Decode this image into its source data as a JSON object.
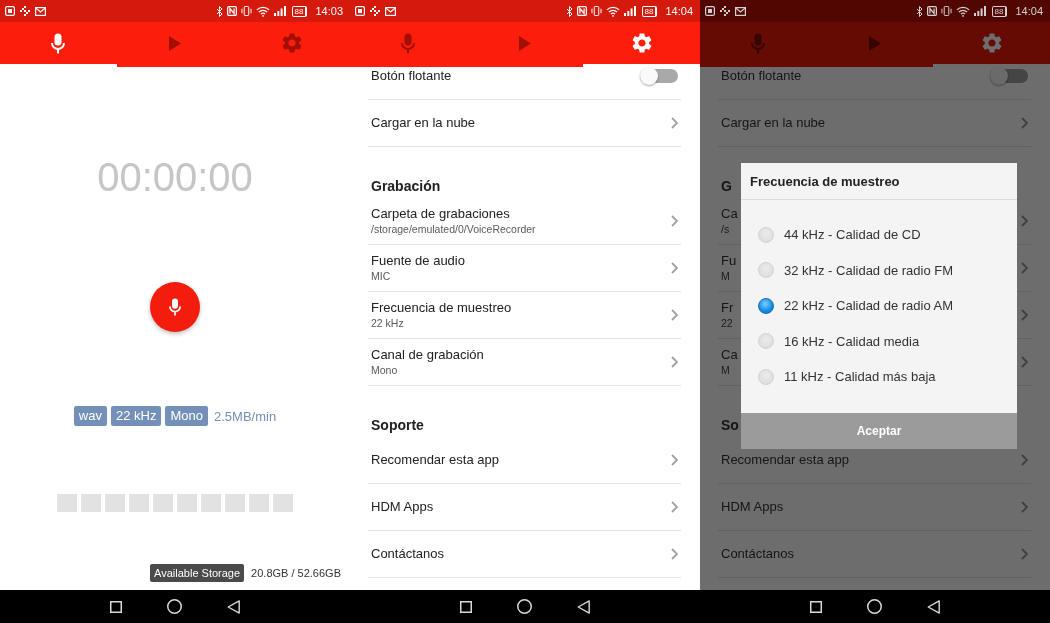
{
  "screens": [
    {
      "kind": "recorder",
      "dimmed": false,
      "status_bar": {
        "battery": "88",
        "time": "14:03"
      },
      "tabs": [
        {
          "kind": "microphone",
          "selected": true
        },
        {
          "kind": "play",
          "selected": false
        },
        {
          "kind": "settings",
          "selected": false
        }
      ],
      "timer": "00:00:00",
      "format_tags": [
        "wav",
        "22 kHz",
        "Mono"
      ],
      "bitrate": "2.5MB/min",
      "storage": {
        "label": "Available Storage",
        "value": "20.8GB / 52.66GB"
      }
    },
    {
      "kind": "settings",
      "dimmed": false,
      "status_bar": {
        "battery": "88",
        "time": "14:04"
      },
      "tabs": [
        {
          "kind": "microphone",
          "selected": false
        },
        {
          "kind": "play",
          "selected": false
        },
        {
          "kind": "settings",
          "selected": true
        }
      ],
      "items": [
        {
          "kind": "toggle",
          "title": "Botón flotante",
          "on": false
        },
        {
          "kind": "link",
          "title": "Cargar en la nube"
        },
        {
          "kind": "header",
          "title": "Grabación"
        },
        {
          "kind": "link",
          "title": "Carpeta de grabaciones",
          "value": "/storage/emulated/0/VoiceRecorder"
        },
        {
          "kind": "link",
          "title": "Fuente de audio",
          "value": "MIC"
        },
        {
          "kind": "link",
          "title": "Frecuencia de muestreo",
          "value": "22 kHz"
        },
        {
          "kind": "link",
          "title": "Canal de grabación",
          "value": "Mono"
        },
        {
          "kind": "header",
          "title": "Soporte"
        },
        {
          "kind": "link",
          "title": "Recomendar esta app"
        },
        {
          "kind": "link",
          "title": "HDM Apps"
        },
        {
          "kind": "link",
          "title": "Contáctanos"
        }
      ]
    },
    {
      "kind": "settings",
      "dimmed": true,
      "status_bar": {
        "battery": "88",
        "time": "14:04"
      },
      "tabs": [
        {
          "kind": "microphone",
          "selected": false
        },
        {
          "kind": "play",
          "selected": false
        },
        {
          "kind": "settings",
          "selected": true
        }
      ],
      "items": [
        {
          "kind": "toggle",
          "title": "Botón flotante",
          "on": false
        },
        {
          "kind": "link",
          "title": "Cargar en la nube"
        },
        {
          "kind": "header",
          "title": "G"
        },
        {
          "kind": "link",
          "title": "Ca",
          "value": "/s"
        },
        {
          "kind": "link",
          "title": "Fu",
          "value": "M"
        },
        {
          "kind": "link",
          "title": "Fr",
          "value": "22"
        },
        {
          "kind": "link",
          "title": "Ca",
          "value": "M"
        },
        {
          "kind": "header",
          "title": "So"
        },
        {
          "kind": "link",
          "title": "Recomendar esta app"
        },
        {
          "kind": "link",
          "title": "HDM Apps"
        },
        {
          "kind": "link",
          "title": "Contáctanos"
        }
      ],
      "dialog": {
        "title": "Frecuencia de muestreo",
        "options": [
          {
            "label": "44 kHz - Calidad de CD",
            "selected": false
          },
          {
            "label": "32 kHz - Calidad de radio FM",
            "selected": false
          },
          {
            "label": "22 kHz - Calidad de radio AM",
            "selected": true
          },
          {
            "label": "16 kHz - Calidad media",
            "selected": false
          },
          {
            "label": "11 kHz - Calidad más baja",
            "selected": false
          }
        ],
        "button": "Aceptar"
      }
    }
  ]
}
